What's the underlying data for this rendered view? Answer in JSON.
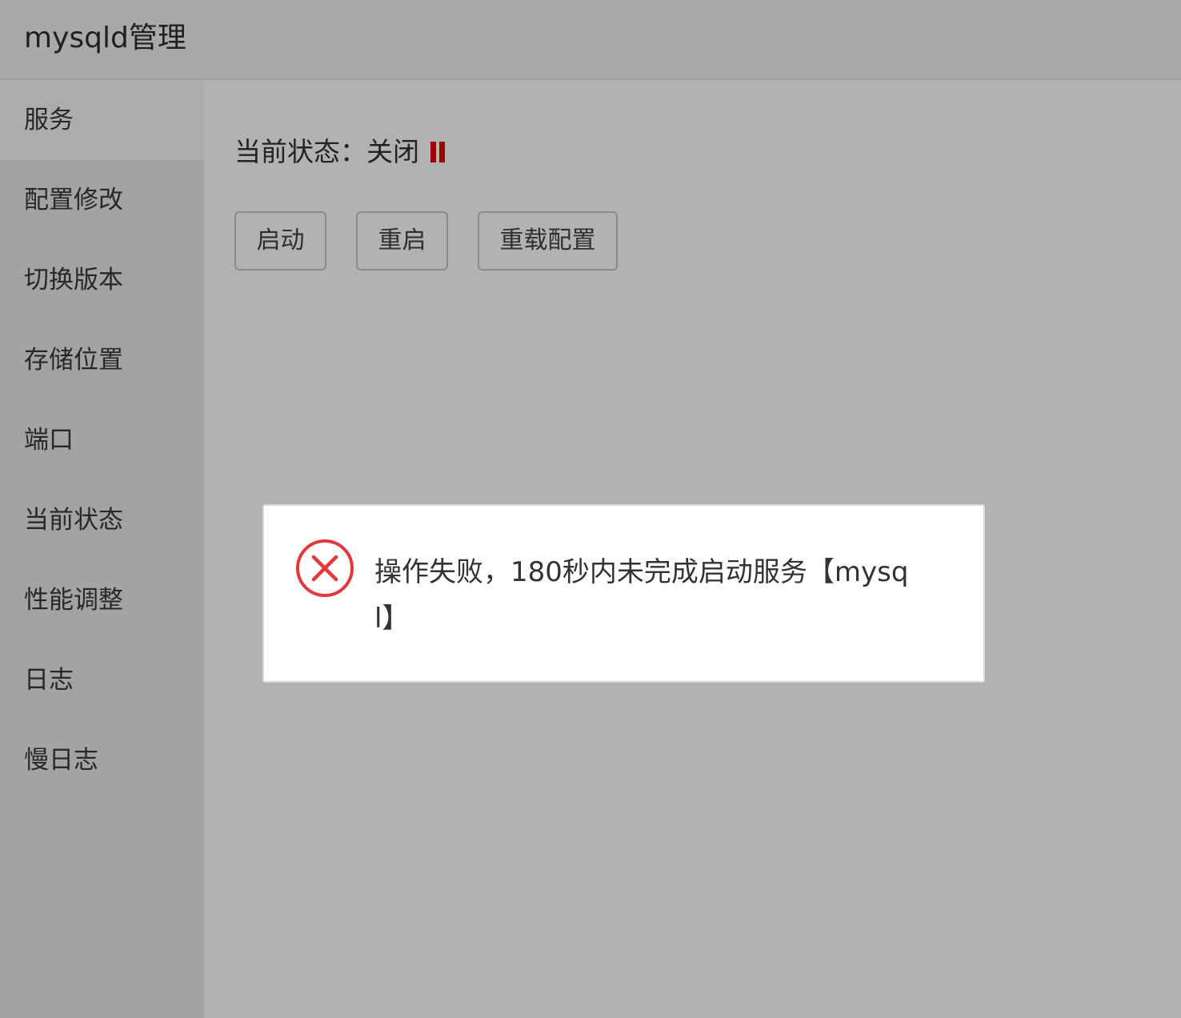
{
  "header": {
    "title": "mysqld管理"
  },
  "sidebar": {
    "items": [
      {
        "label": "服务",
        "active": true
      },
      {
        "label": "配置修改"
      },
      {
        "label": "切换版本"
      },
      {
        "label": "存储位置"
      },
      {
        "label": "端口"
      },
      {
        "label": "当前状态"
      },
      {
        "label": "性能调整"
      },
      {
        "label": "日志"
      },
      {
        "label": "慢日志"
      }
    ]
  },
  "main": {
    "status_label": "当前状态：",
    "status_value": "关闭",
    "status_icon": "pause-icon",
    "status_color": "#e00000",
    "buttons": {
      "start": "启动",
      "restart": "重启",
      "reload": "重载配置"
    }
  },
  "dialog": {
    "icon": "error-circle-x-icon",
    "icon_color": "#e0393e",
    "message": "操作失败，180秒内未完成启动服务【mysql】"
  }
}
